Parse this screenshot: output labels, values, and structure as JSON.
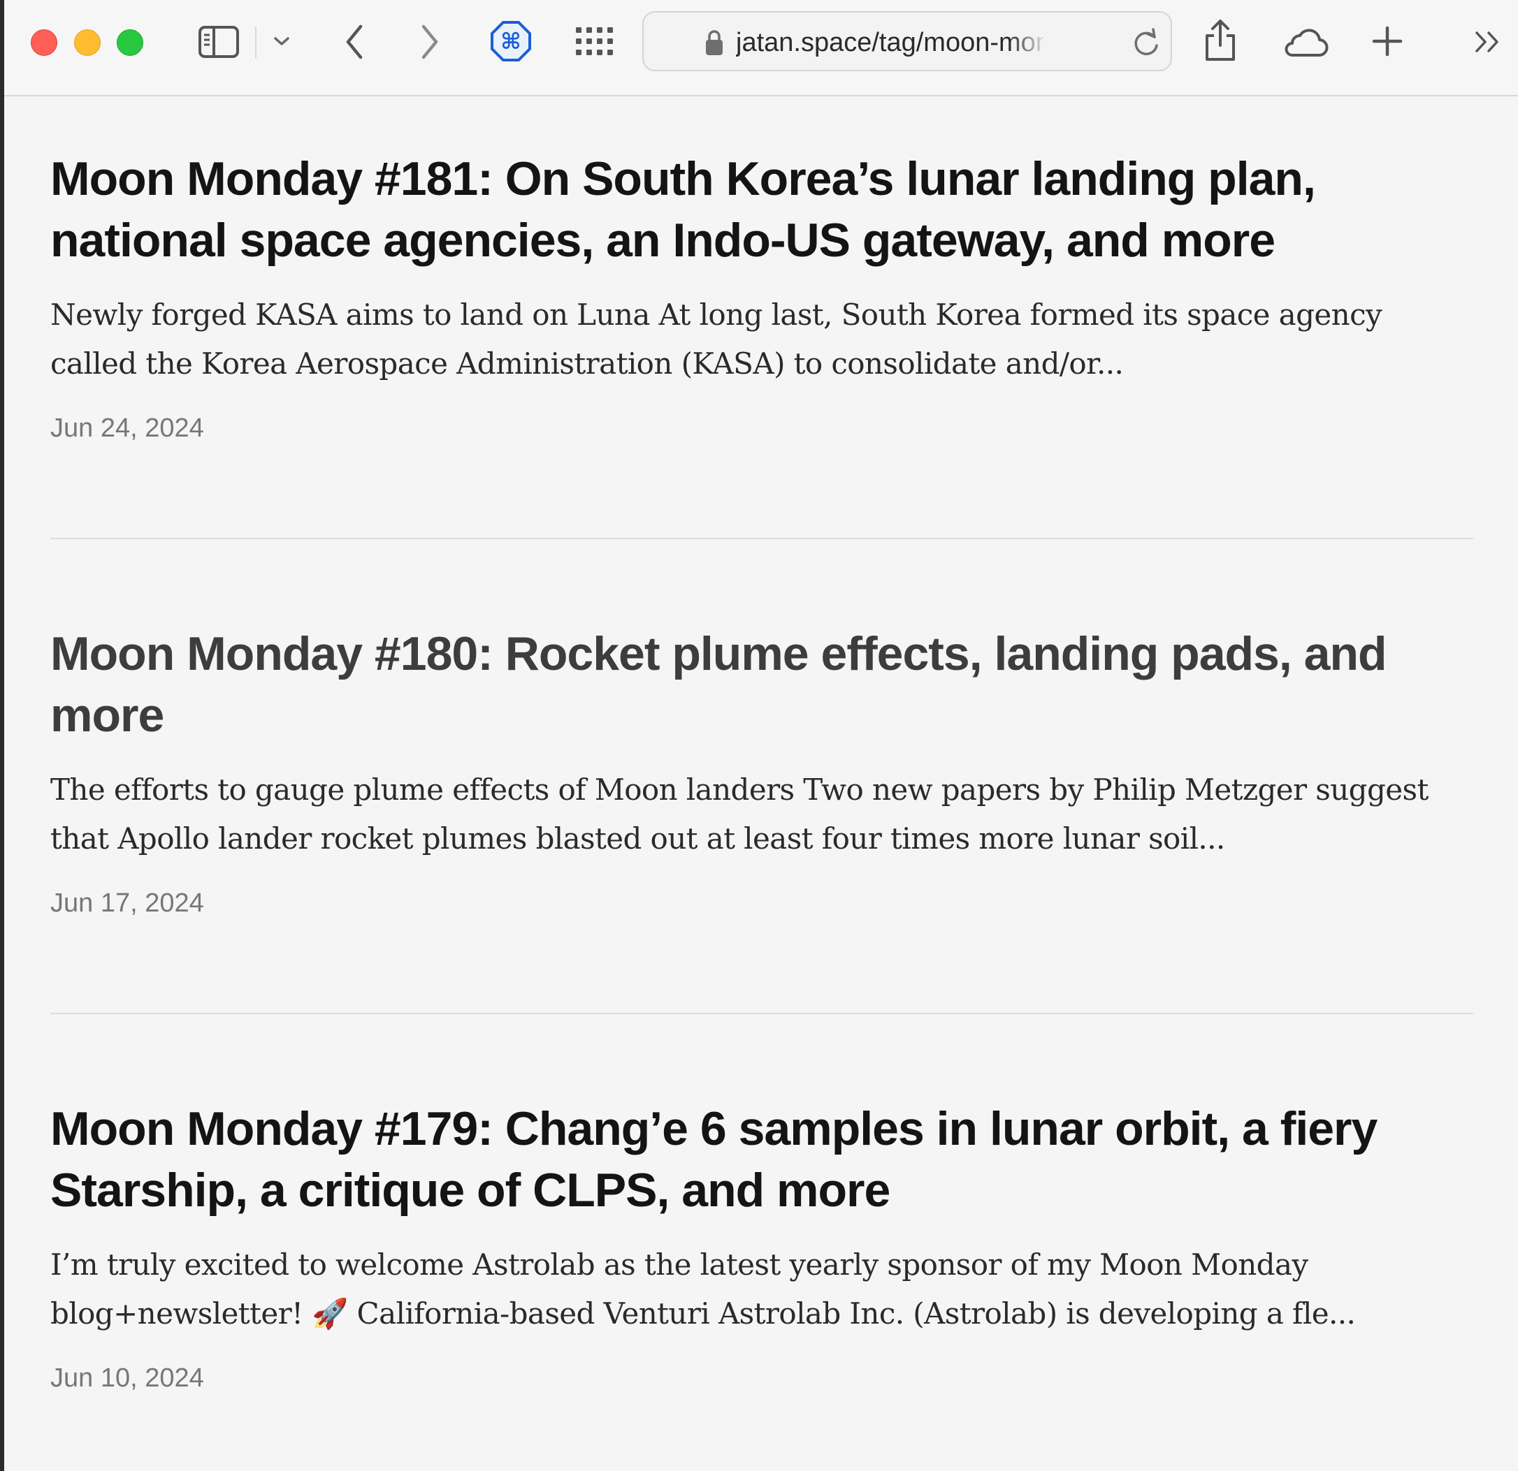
{
  "browser": {
    "address_bar": {
      "url": "jatan.space/tag/moon-monday/"
    },
    "icons": {
      "sidebar": "sidebar-icon",
      "sidebar_menu": "chevron-down-icon",
      "back": "chevron-left-icon",
      "forward": "chevron-right-icon",
      "extension": "command-key-icon",
      "tab_overview": "grid-icon",
      "lock": "lock-icon",
      "reload": "reload-icon",
      "share": "share-icon",
      "cloud": "cloud-icon",
      "new_tab": "plus-icon",
      "more": "double-chevron-right-icon"
    },
    "colors": {
      "close": "#ff5f57",
      "minimize": "#febc2e",
      "zoom": "#28c840",
      "extension_accent": "#1a5fd6"
    }
  },
  "posts": [
    {
      "title": "Moon Monday #181: On South Korea’s lunar landing plan, national space agencies, an Indo-US gateway, and more",
      "excerpt": "Newly forged KASA aims to land on Luna At long last, South Korea formed its space agency called the Korea Aerospace Administration (KASA) to consolidate and/or...",
      "date": "Jun 24, 2024"
    },
    {
      "title": "Moon Monday #180: Rocket plume effects, landing pads, and more",
      "excerpt": "The efforts to gauge plume effects of Moon landers Two new papers by Philip Metzger suggest that Apollo lander rocket plumes blasted out at least four times more lunar soil...",
      "date": "Jun 17, 2024"
    },
    {
      "title": "Moon Monday #179: Chang’e 6 samples in lunar orbit, a fiery Starship, a critique of CLPS, and more",
      "excerpt": "I’m truly excited to welcome Astrolab as the latest yearly sponsor of my Moon Monday blog+newsletter! 🚀 California-based Venturi Astrolab Inc. (Astrolab) is developing a fle...",
      "date": "Jun 10, 2024"
    }
  ]
}
